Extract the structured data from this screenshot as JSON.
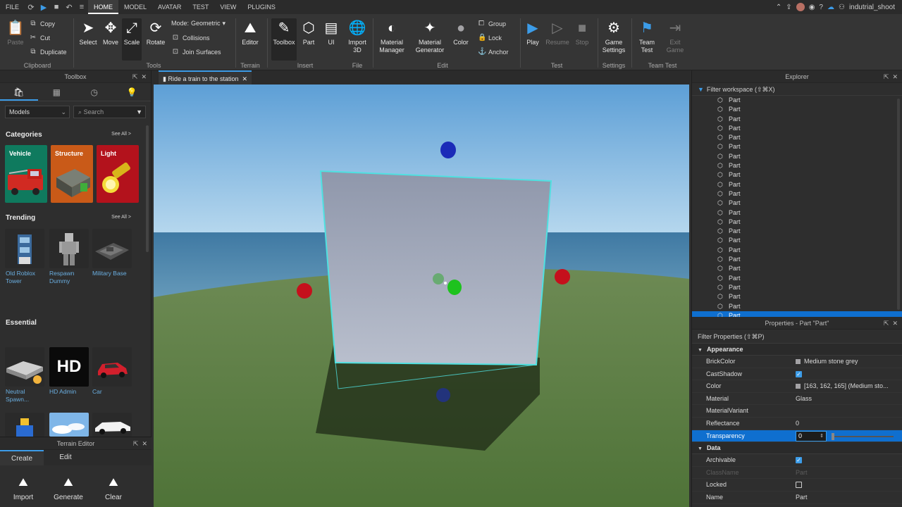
{
  "menubar": {
    "file": "FILE",
    "tabs": [
      "HOME",
      "MODEL",
      "AVATAR",
      "TEST",
      "VIEW",
      "PLUGINS"
    ],
    "active_tab": "HOME",
    "username": "indutrial_shoot"
  },
  "ribbon": {
    "clipboard": {
      "paste": "Paste",
      "copy": "Copy",
      "cut": "Cut",
      "duplicate": "Duplicate",
      "group": "Clipboard"
    },
    "tools": {
      "select": "Select",
      "move": "Move",
      "scale": "Scale",
      "rotate": "Rotate",
      "mode_label": "Mode:",
      "mode_value": "Geometric",
      "collisions": "Collisions",
      "join_surfaces": "Join Surfaces",
      "group": "Tools"
    },
    "terrain": {
      "editor": "Editor",
      "group": "Terrain"
    },
    "insert": {
      "toolbox": "Toolbox",
      "part": "Part",
      "ui": "UI",
      "group": "Insert"
    },
    "file": {
      "import3d_1": "Import",
      "import3d_2": "3D",
      "group": "File"
    },
    "edit": {
      "material_manager_1": "Material",
      "material_manager_2": "Manager",
      "material_generator_1": "Material",
      "material_generator_2": "Generator",
      "color": "Color",
      "group_btn": "Group",
      "lock": "Lock",
      "anchor": "Anchor",
      "group": "Edit"
    },
    "test": {
      "play": "Play",
      "resume": "Resume",
      "stop": "Stop",
      "group": "Test"
    },
    "settings": {
      "game_settings_1": "Game",
      "game_settings_2": "Settings",
      "group": "Settings"
    },
    "team_test": {
      "team_test_1": "Team",
      "team_test_2": "Test",
      "exit_game_1": "Exit",
      "exit_game_2": "Game",
      "group": "Team Test"
    }
  },
  "toolbox": {
    "title": "Toolbox",
    "dropdown": "Models",
    "search_placeholder": "Search",
    "categories_heading": "Categories",
    "see_all": "See All >",
    "categories": [
      {
        "label": "Vehicle",
        "color": "#0f7a5e"
      },
      {
        "label": "Structure",
        "color": "#c95a18"
      },
      {
        "label": "Light",
        "color": "#b3121c"
      }
    ],
    "trending_heading": "Trending",
    "trending": [
      {
        "line1": "Old Roblox",
        "line2": "Tower"
      },
      {
        "line1": "Respawn",
        "line2": "Dummy"
      },
      {
        "line1": "Military Base",
        "line2": ""
      }
    ],
    "essential_heading": "Essential",
    "essential": [
      {
        "line1": "Neutral",
        "line2": "Spawn..."
      },
      {
        "line1": "HD Admin",
        "line2": ""
      },
      {
        "line1": "Car",
        "line2": ""
      }
    ],
    "hd_logo": "HD"
  },
  "terrain_editor": {
    "title": "Terrain Editor",
    "tabs": [
      "Create",
      "Edit"
    ],
    "buttons": [
      "Import",
      "Generate",
      "Clear"
    ]
  },
  "viewport": {
    "tab_label": "Ride a train to the station",
    "colors": {
      "sky_top": "#5d9fd6",
      "sky_bottom": "#a9cde6",
      "sea": "#3f79a3",
      "grass": "#5a7d43",
      "part": "#8a93a8",
      "selection": "#4fe0e0"
    }
  },
  "explorer": {
    "title": "Explorer",
    "filter": "Filter workspace (⇧⌘X)",
    "items": [
      "Part",
      "Part",
      "Part",
      "Part",
      "Part",
      "Part",
      "Part",
      "Part",
      "Part",
      "Part",
      "Part",
      "Part",
      "Part",
      "Part",
      "Part",
      "Part",
      "Part",
      "Part",
      "Part",
      "Part",
      "Part",
      "Part",
      "Part",
      "Part"
    ],
    "selected_index": 23
  },
  "properties": {
    "title": "Properties - Part \"Part\"",
    "filter": "Filter Properties (⇧⌘P)",
    "appearance_heading": "Appearance",
    "appearance": {
      "brickcolor_name": "BrickColor",
      "brickcolor_value": "Medium stone grey",
      "castshadow_name": "CastShadow",
      "color_name": "Color",
      "color_value": "[163, 162, 165] (Medium sto...",
      "material_name": "Material",
      "material_value": "Glass",
      "materialvariant_name": "MaterialVariant",
      "materialvariant_value": "",
      "reflectance_name": "Reflectance",
      "reflectance_value": "0",
      "transparency_name": "Transparency",
      "transparency_value": "0"
    },
    "data_heading": "Data",
    "data": {
      "archivable_name": "Archivable",
      "classname_name": "ClassName",
      "classname_value": "Part",
      "locked_name": "Locked",
      "name_name": "Name",
      "name_value": "Part"
    }
  }
}
